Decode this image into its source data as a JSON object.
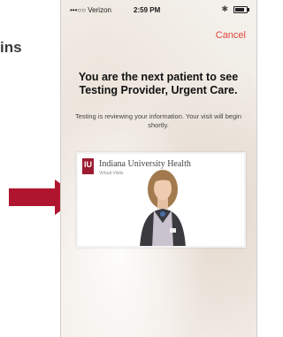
{
  "side_label": "ins",
  "status_bar": {
    "carrier": "•••○○ Verizon",
    "time": "2:59 PM"
  },
  "nav": {
    "cancel_label": "Cancel"
  },
  "main": {
    "headline": "You are the next patient to see Testing Provider, Urgent Care.",
    "subtext": "Testing is reviewing your information. Your visit will begin shortly."
  },
  "video": {
    "logo_text": "IU",
    "brand_text": "Indiana University Health",
    "sub_text": "Virtual Visits"
  },
  "colors": {
    "accent": "#e2453a",
    "arrow": "#b0152f",
    "brand": "#9b1b30"
  }
}
